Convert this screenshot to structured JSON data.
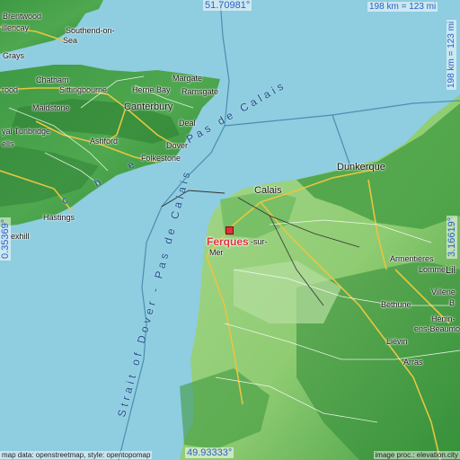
{
  "coords": {
    "top_lat": "51.70981°",
    "bottom_lat": "49.93333°",
    "left_lon": "0.35369°",
    "right_lon": "3.16619°",
    "scale": "198 km = 123 mi"
  },
  "marker": {
    "name": "Ferques"
  },
  "seas": {
    "pas_de_calais": "Pas de Calais",
    "strait_of_dover": "Strait of Dover - Pas de Calais",
    "manche_fragment": "c h e"
  },
  "places": {
    "brentwood": "Brentwood",
    "billericay": "illericay",
    "southend": "Southend-on-",
    "sea": "Sea",
    "grays": "Grays",
    "chatham": "Chatham",
    "margate": "Margate",
    "sittingbourne": "Sittingbourne",
    "herne_bay": "Herne Bay",
    "ramsgate": "Ramsgate",
    "rood": "rood",
    "maidstone": "Maidstone",
    "canterbury": "Canterbury",
    "deal": "Deal",
    "tunbridge": "yal Tunbridge",
    "wells": "ells",
    "ashford": "Ashford",
    "dover": "Dover",
    "folkestone": "Folkestone",
    "hastings": "Hastings",
    "bexhill": "exhill",
    "calais": "Calais",
    "dunkerque": "Dunkerque",
    "sur": "-sur-",
    "mer": "Mer",
    "armentieres": "Armentières",
    "lomme": "Lomme",
    "lil": "Lil",
    "villene": "Villene",
    "b": "B",
    "bethune": "Béthune",
    "henin": "Hénin-",
    "beaumont": "ens-Beaumo",
    "lievin": "Liévin",
    "arras": "Arras"
  },
  "attribution": {
    "left": "map data: openstreetmap, style: opentopomap",
    "right": "image proc.: elevation.city"
  },
  "colors": {
    "sea": "#8fcde0",
    "land_low": "#8fce7a",
    "land_high": "#2e8a35",
    "marker": "#e0303a",
    "coord_text": "#2b61c5"
  }
}
